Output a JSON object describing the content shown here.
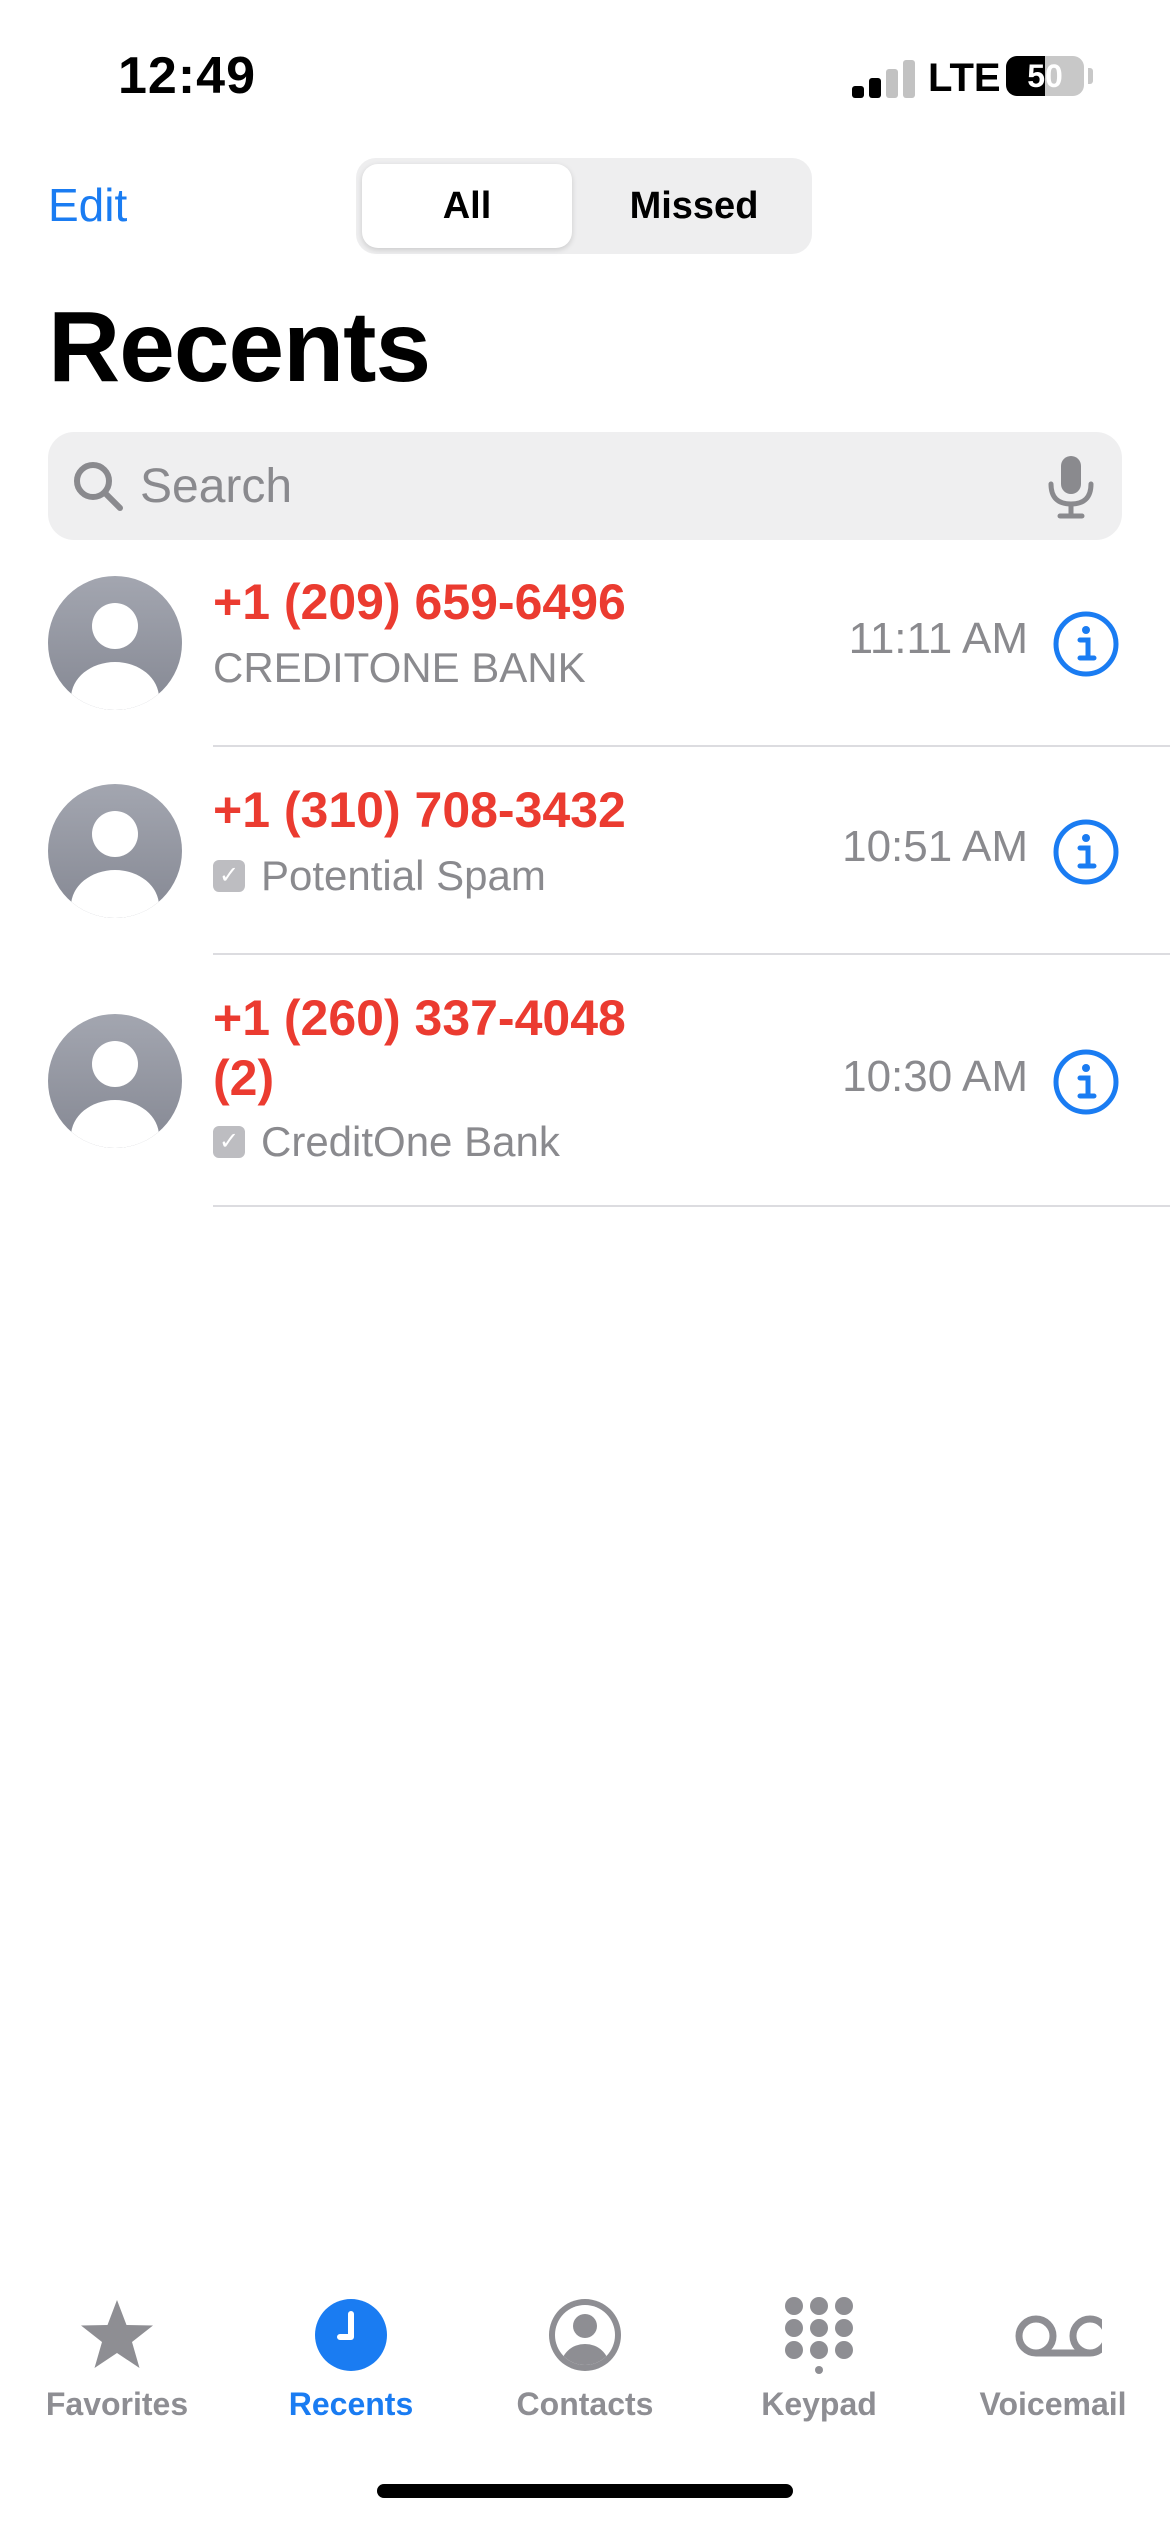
{
  "status_bar": {
    "time": "12:49",
    "network": "LTE",
    "battery_percent": "50",
    "battery_level": 0.5,
    "signal_bars_active": 2,
    "signal_bars_total": 4
  },
  "header": {
    "edit_label": "Edit",
    "segments": [
      "All",
      "Missed"
    ],
    "selected_segment": "All",
    "title": "Recents"
  },
  "search": {
    "placeholder": "Search",
    "value": ""
  },
  "calls": [
    {
      "number": "+1 (209) 659-6496",
      "subtitle": "CREDITONE BANK",
      "time": "11:11 AM",
      "verified_check": false,
      "missed": true
    },
    {
      "number": "+1 (310) 708-3432",
      "subtitle": "Potential Spam",
      "time": "10:51 AM",
      "verified_check": true,
      "missed": true
    },
    {
      "number_line1": "+1 (260) 337-4048",
      "number_line2": "(2)",
      "subtitle": "CreditOne Bank",
      "time": "10:30 AM",
      "verified_check": true,
      "missed": true
    }
  ],
  "tab_bar": {
    "tabs": [
      {
        "label": "Favorites",
        "icon": "star-icon"
      },
      {
        "label": "Recents",
        "icon": "clock-icon"
      },
      {
        "label": "Contacts",
        "icon": "person-circle-icon"
      },
      {
        "label": "Keypad",
        "icon": "keypad-icon"
      },
      {
        "label": "Voicemail",
        "icon": "voicemail-icon"
      }
    ],
    "active": "Recents"
  },
  "colors": {
    "accent": "#1a7cf2",
    "missed_call": "#eb3b30",
    "secondary_text": "#8a8a8e",
    "inactive_tab": "#8e8e93"
  }
}
